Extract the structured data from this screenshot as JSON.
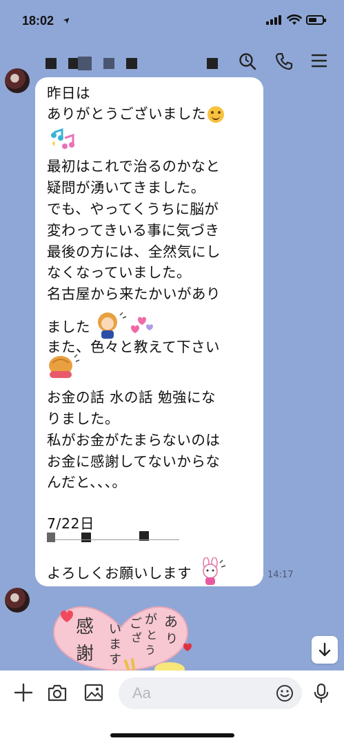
{
  "status": {
    "time": "18:02",
    "location_glyph": "➤"
  },
  "header": {
    "icons": [
      "search-icon",
      "phone-icon",
      "menu-icon"
    ]
  },
  "message": {
    "lines": [
      "昨日は",
      "ありがとうございました",
      "",
      "最初はこれで治るのかなと",
      "疑問が湧いてきました。",
      "でも、やってくうちに脳が",
      "変わってきいる事に気づき",
      "最後の方には、全然気にし",
      "なくなっていました。",
      "名古屋から来たかいがあり",
      "ました",
      "また、色々と教えて下さい",
      "",
      "お金の話 水の話 勉強にな",
      "りました。",
      "私がお金がたまらないのは",
      "お金に感謝してないからな",
      "んだと、、、。",
      "",
      "7/22日",
      "",
      "よろしくお願いします"
    ],
    "time": "14:17"
  },
  "sticker": {
    "text": "感謝 いまございが ありとう"
  },
  "composer": {
    "placeholder": "Aa"
  },
  "colors": {
    "chat_bg": "#8fa7d6",
    "bubble": "#ffffff",
    "toolbar": "#ffffff"
  }
}
